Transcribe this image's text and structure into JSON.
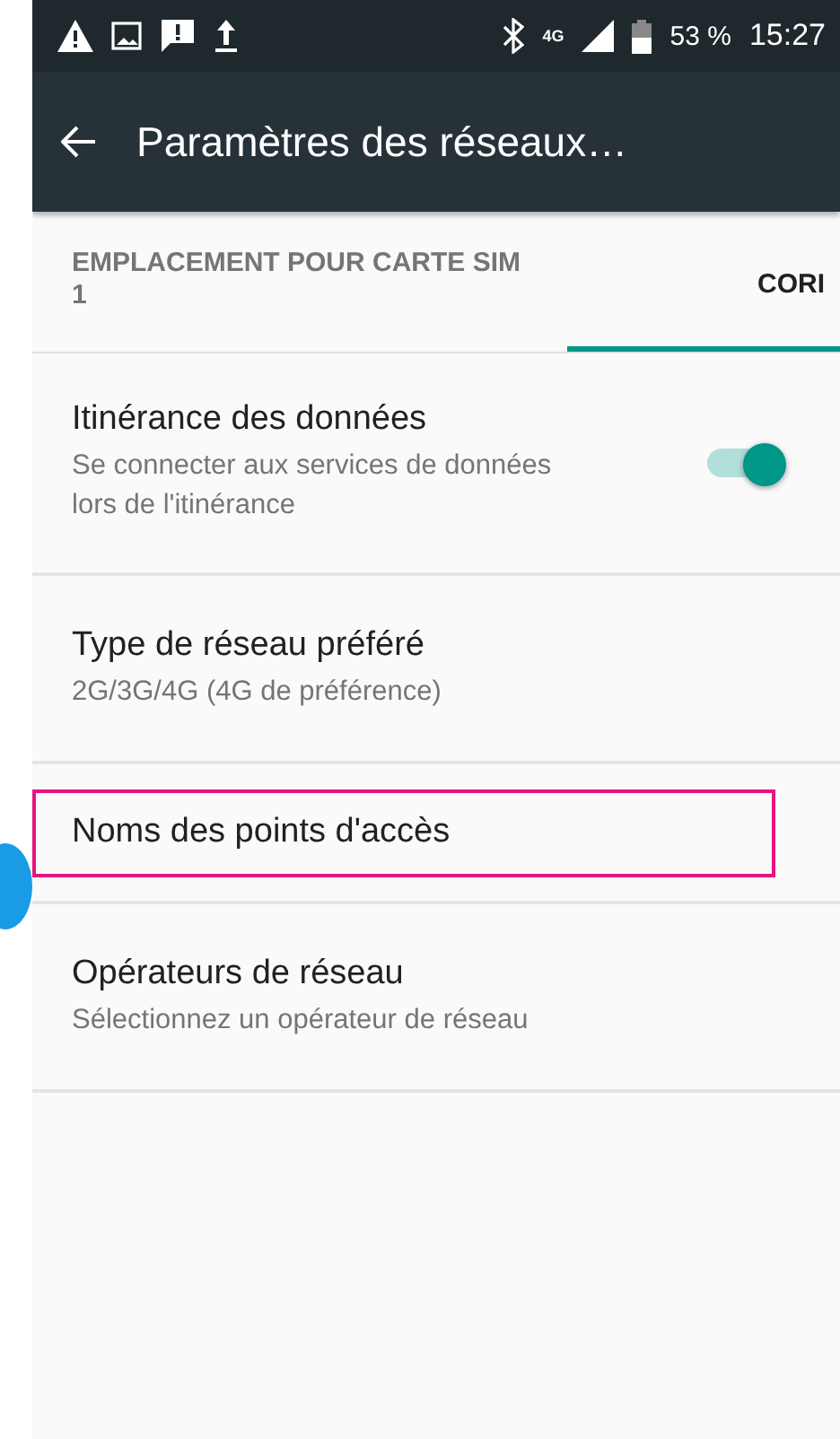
{
  "status_bar": {
    "network_type": "4G",
    "battery": "53 %",
    "time": "15:27"
  },
  "toolbar": {
    "title": "Paramètres des réseaux…"
  },
  "tabs": [
    {
      "label": "EMPLACEMENT POUR CARTE SIM 1",
      "selected": false
    },
    {
      "label": "CORI",
      "selected": true
    }
  ],
  "items": [
    {
      "kind": "switch",
      "title": "Itinérance des données",
      "summary": "Se connecter aux services de données lors de l'itinérance",
      "on": true,
      "highlighted": false
    },
    {
      "kind": "text",
      "title": "Type de réseau préféré",
      "summary": "2G/3G/4G (4G de préférence)",
      "highlighted": false
    },
    {
      "kind": "text",
      "title": "Noms des points d'accès",
      "highlighted": true
    },
    {
      "kind": "text",
      "title": "Opérateurs de réseau",
      "summary": "Sélectionnez un opérateur de réseau",
      "highlighted": false
    }
  ]
}
